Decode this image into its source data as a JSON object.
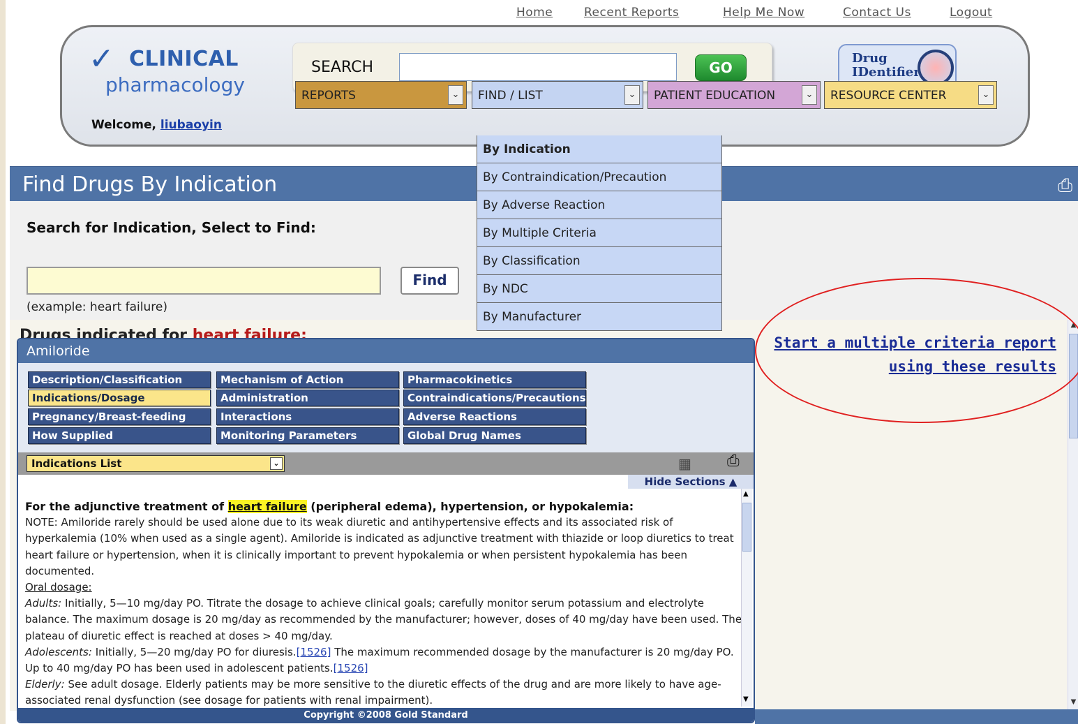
{
  "toplinks": [
    "Home",
    "Recent Reports",
    "Help Me Now",
    "Contact Us",
    "Logout"
  ],
  "logo": {
    "line1": "CLINICAL",
    "line2": "pharmacology"
  },
  "search": {
    "label": "SEARCH",
    "value": "",
    "go": "GO"
  },
  "drugid": {
    "line1": "Drug",
    "line2": "IDentifier"
  },
  "welcome": {
    "text": "Welcome,",
    "user": "liubaoyin"
  },
  "nav": [
    {
      "label": "REPORTS",
      "color": "#c9973f"
    },
    {
      "label": "FIND / LIST",
      "color": "#c4d4f2"
    },
    {
      "label": "PATIENT EDUCATION",
      "color": "#d3a6d6"
    },
    {
      "label": "RESOURCE CENTER",
      "color": "#f6dc85"
    }
  ],
  "dropdown": [
    "By Indication",
    "By Contraindication/Precaution",
    "By Adverse Reaction",
    "By Multiple Criteria",
    "By Classification",
    "By NDC",
    "By Manufacturer"
  ],
  "page": {
    "title": "Find Drugs By Indication",
    "search_label": "Search for Indication, Select to Find:",
    "find_button": "Find",
    "example": "(example: heart failure)",
    "results_prefix": "Drugs indicated for",
    "results_keyword": "heart failure:"
  },
  "multi_link": {
    "line1": "Start a multiple criteria report",
    "line2": "using these results"
  },
  "drug": {
    "name": "Amiloride",
    "tabs": [
      "Description/Classification",
      "Mechanism of Action",
      "Pharmacokinetics",
      "Indications/Dosage",
      "Administration",
      "Contraindications/Precautions",
      "Pregnancy/Breast-feeding",
      "Interactions",
      "Adverse Reactions",
      "How Supplied",
      "Monitoring Parameters",
      "Global Drug Names"
    ],
    "section_select": "Indications List",
    "hide_sections": "Hide Sections",
    "content": {
      "h_pre": "For the adjunctive treatment of",
      "h_kw": "heart failure",
      "h_post": "(peripheral edema), hypertension, or hypokalemia:",
      "note": "NOTE: Amiloride rarely should be used alone due to its weak diuretic and antihypertensive effects and its associated risk of hyperkalemia (10% when used as a single agent). Amiloride is indicated as adjunctive treatment with thiazide or loop diuretics to treat heart failure or hypertension, when it is clinically important to prevent hypokalemia or when persistent hypokalemia has been documented.",
      "oral": "Oral dosage:",
      "adults_label": "Adults:",
      "adults": "Initially, 5—10 mg/day PO. Titrate the dosage to achieve clinical goals; carefully monitor serum potassium and electrolyte balance. The maximum dosage is 20 mg/day as recommended by the manufacturer; however, doses of 40 mg/day have been used. The plateau of diuretic effect is reached at doses > 40 mg/day.",
      "adol_label": "Adolescents:",
      "adol1": "Initially, 5—20 mg/day PO for diuresis.",
      "ref1": "[1526]",
      "adol2": "The maximum recommended dosage by the manufacturer is 20 mg/day PO. Up to 40 mg/day PO has been used in adolescent patients.",
      "ref2": "[1526]",
      "eld_label": "Elderly:",
      "eld": "See adult dosage. Elderly patients may be more sensitive to the diuretic effects of the drug and are more likely to have age-associated renal dysfunction (see dosage for patients with renal impairment)."
    },
    "footer": "Copyright ©2008 Gold Standard"
  }
}
